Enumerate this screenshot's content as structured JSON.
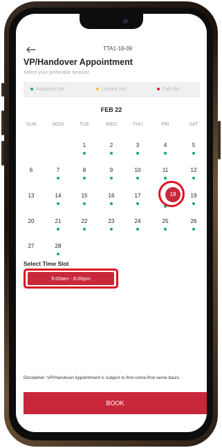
{
  "header": {
    "back_icon": "arrow-left-icon",
    "unit_code": "TTA1-16-09",
    "title": "VP/Handover Appointment",
    "subtitle": "Select your preferable timeslot."
  },
  "legend": [
    {
      "label": "Available slot",
      "color": "#19a86a"
    },
    {
      "label": "Limited slot",
      "color": "#f0c419"
    },
    {
      "label": "Full slot",
      "color": "#d6202e"
    }
  ],
  "calendar": {
    "month": "FEB 22",
    "weekdays": [
      "SUN",
      "MON",
      "TUE",
      "WED",
      "THU",
      "FRI",
      "SAT"
    ],
    "selected_day": "18"
  },
  "time_slot": {
    "title": "Select Time Slot",
    "selected": "9:00am - 6:00pm"
  },
  "disclaimer": "Disclaimer: VP/Handover Appointment is subject to first-come-first-serve basis.",
  "book_label": "BOOK",
  "colors": {
    "accent": "#c8283a",
    "available": "#19a86a"
  }
}
